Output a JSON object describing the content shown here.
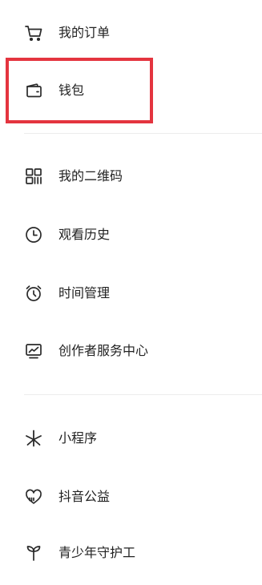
{
  "menu": {
    "items": [
      {
        "label": "我的订单",
        "icon": "cart-icon"
      },
      {
        "label": "钱包",
        "icon": "wallet-icon"
      },
      {
        "label": "我的二维码",
        "icon": "qr-code-icon"
      },
      {
        "label": "观看历史",
        "icon": "clock-icon"
      },
      {
        "label": "时间管理",
        "icon": "alarm-clock-icon"
      },
      {
        "label": "创作者服务中心",
        "icon": "chart-monitor-icon"
      },
      {
        "label": "小程序",
        "icon": "mini-program-icon"
      },
      {
        "label": "抖音公益",
        "icon": "charity-heart-icon"
      },
      {
        "label": "青少年守护工",
        "icon": "sprout-icon"
      }
    ]
  },
  "highlight": {
    "color": "#e4343f"
  },
  "colors": {
    "text": "#222222",
    "icon": "#2a2a2a",
    "divider": "#ececec"
  }
}
